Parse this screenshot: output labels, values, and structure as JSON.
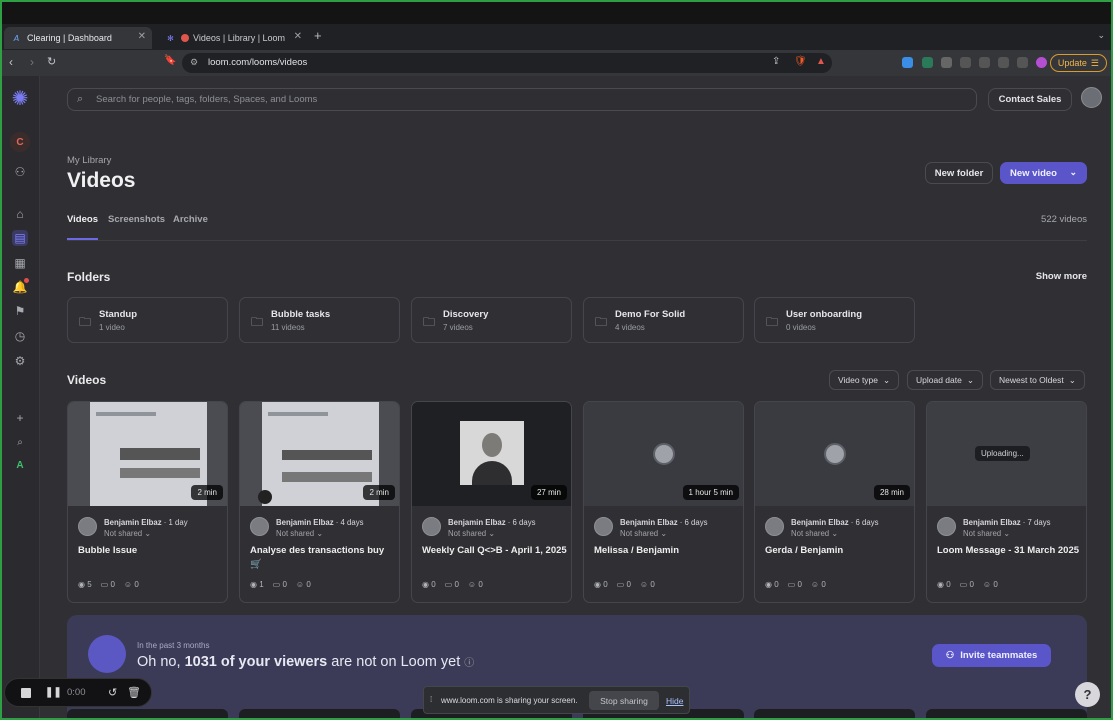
{
  "browser": {
    "tabs": [
      {
        "title": "Clearing | Dashboard",
        "active": true
      },
      {
        "title": "Videos | Library | Loom",
        "active": false
      }
    ],
    "url": "loom.com/looms/videos",
    "update_label": "Update"
  },
  "header": {
    "search_placeholder": "Search for people, tags, folders, Spaces, and Looms",
    "contact_sales": "Contact Sales"
  },
  "rail": {
    "workspace_initial": "C",
    "bottom_initial": "A"
  },
  "page": {
    "library_label": "My Library",
    "title": "Videos",
    "new_folder": "New folder",
    "new_video": "New video",
    "tabs": [
      "Videos",
      "Screenshots",
      "Archive"
    ],
    "video_count": "522 videos"
  },
  "folders_section": {
    "title": "Folders",
    "show_more": "Show more",
    "items": [
      {
        "name": "Standup",
        "count": "1 video"
      },
      {
        "name": "Bubble tasks",
        "count": "11 videos"
      },
      {
        "name": "Discovery",
        "count": "7 videos"
      },
      {
        "name": "Demo For Solid",
        "count": "4 videos"
      },
      {
        "name": "User onboarding",
        "count": "0 videos"
      }
    ]
  },
  "videos_section": {
    "title": "Videos",
    "filters": [
      "Video type",
      "Upload date",
      "Newest to Oldest"
    ],
    "items": [
      {
        "duration": "2 min",
        "author": "Benjamin Elbaz",
        "age": "· 1 day",
        "share": "Not shared",
        "title": "Bubble Issue",
        "views": "5",
        "comments": "0",
        "reactions": "0"
      },
      {
        "duration": "2 min",
        "author": "Benjamin Elbaz",
        "age": "· 4 days",
        "share": "Not shared",
        "title": "Analyse des transactions buy 🛒",
        "views": "1",
        "comments": "0",
        "reactions": "0"
      },
      {
        "duration": "27 min",
        "author": "Benjamin Elbaz",
        "age": "· 6 days",
        "share": "Not shared",
        "title": "Weekly Call Q<>B - April 1, 2025",
        "views": "0",
        "comments": "0",
        "reactions": "0"
      },
      {
        "duration": "1 hour 5 min",
        "author": "Benjamin Elbaz",
        "age": "· 6 days",
        "share": "Not shared",
        "title": "Melissa / Benjamin",
        "views": "0",
        "comments": "0",
        "reactions": "0"
      },
      {
        "duration": "28 min",
        "author": "Benjamin Elbaz",
        "age": "· 6 days",
        "share": "Not shared",
        "title": "Gerda / Benjamin",
        "views": "0",
        "comments": "0",
        "reactions": "0"
      },
      {
        "status": "Uploading...",
        "author": "Benjamin Elbaz",
        "age": "· 7 days",
        "share": "Not shared",
        "title": "Loom Message - 31 March 2025",
        "views": "0",
        "comments": "0",
        "reactions": "0"
      }
    ]
  },
  "invite_banner": {
    "subtitle": "In the past 3 months",
    "headline_pre": "Oh no, ",
    "headline_bold": "1031 of your viewers",
    "headline_post": " are not on Loom yet",
    "button": "Invite teammates"
  },
  "recorder": {
    "time": "0:00"
  },
  "sharing": {
    "text": "www.loom.com is sharing your screen.",
    "stop": "Stop sharing",
    "hide": "Hide"
  },
  "help_label": "?"
}
